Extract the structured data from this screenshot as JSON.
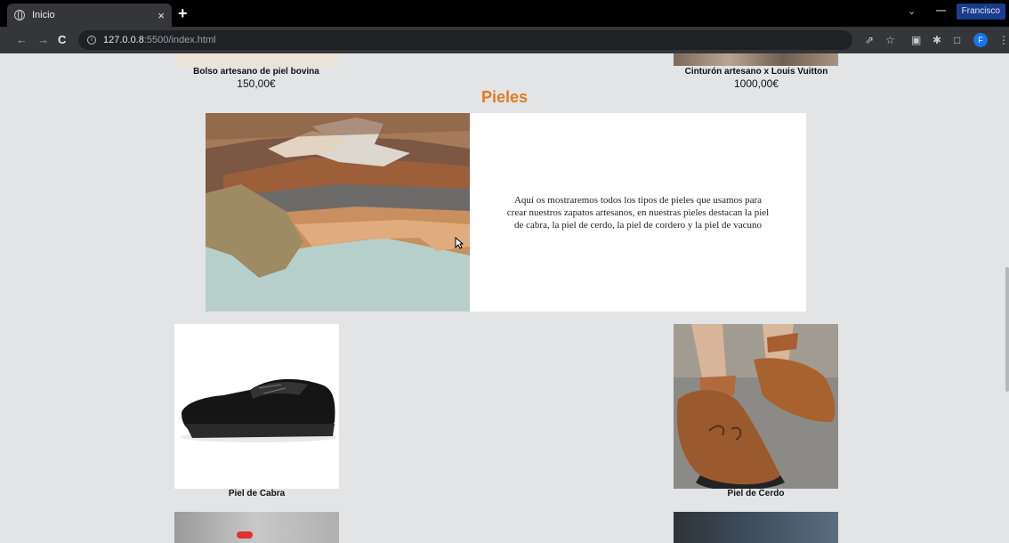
{
  "browser": {
    "tab_title": "Inicio",
    "tab_close": "×",
    "new_tab": "+",
    "url_host": "127.0.0.8",
    "url_rest": ":5500/index.html",
    "profile_name": "Francisco",
    "avatar_letter": "F"
  },
  "products_top": [
    {
      "name": "Bolso artesano de piel bovina",
      "price": "150,00€"
    },
    {
      "name": "Cinturón artesano x Louis Vuitton",
      "price": "1000,00€"
    }
  ],
  "section": {
    "title": "Pieles",
    "description": "Aquí os mostraremos todos los tipos de pieles que usamos para crear nuestros zapatos artesanos, en nuestras pieles destacan la piel de cabra, la piel de cerdo, la piel de cordero y la piel de vacuno"
  },
  "leathers": [
    {
      "label": "Piel de Cabra"
    },
    {
      "label": "Piel de Cerdo"
    }
  ],
  "colors": {
    "accent": "#e07b22",
    "page_bg": "#e3e4e6"
  }
}
